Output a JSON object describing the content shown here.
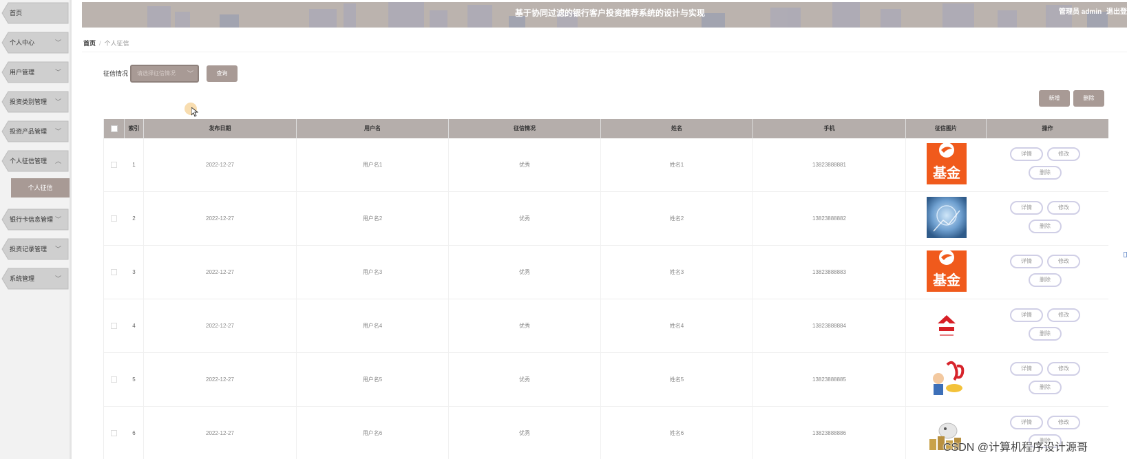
{
  "sidebar": {
    "items": [
      {
        "label": "首页"
      },
      {
        "label": "个人中心"
      },
      {
        "label": "用户管理"
      },
      {
        "label": "投资类别管理"
      },
      {
        "label": "投资产品管理"
      },
      {
        "label": "个人征信管理"
      },
      {
        "label": "银行卡信息管理"
      },
      {
        "label": "投资记录管理"
      },
      {
        "label": "系统管理"
      }
    ],
    "active_sub": "个人征信",
    "chevron_down": "﹀",
    "chevron_up": "︿"
  },
  "header": {
    "title": "基于协同过滤的银行客户投资推荐系统的设计与实现",
    "user": "管理员 admin",
    "logout": "退出登录"
  },
  "breadcrumb": {
    "home": "首页",
    "separator": "/",
    "current": "个人征信"
  },
  "search": {
    "label": "征信情况",
    "placeholder": "请选择征信情况",
    "button": "查询"
  },
  "actions": {
    "add": "新增",
    "delete": "删除"
  },
  "table": {
    "columns": [
      "索引",
      "发布日期",
      "用户名",
      "征信情况",
      "姓名",
      "手机",
      "征信图片",
      "操作"
    ],
    "rows": [
      {
        "index": "1",
        "date": "2022-12-27",
        "username": "用户名1",
        "credit": "优秀",
        "name": "姓名1",
        "phone": "13823888881",
        "image": "fund-logo"
      },
      {
        "index": "2",
        "date": "2022-12-27",
        "username": "用户名2",
        "credit": "优秀",
        "name": "姓名2",
        "phone": "13823888882",
        "image": "finance-blue"
      },
      {
        "index": "3",
        "date": "2022-12-27",
        "username": "用户名3",
        "credit": "优秀",
        "name": "姓名3",
        "phone": "13823888883",
        "image": "fund-logo"
      },
      {
        "index": "4",
        "date": "2022-12-27",
        "username": "用户名4",
        "credit": "优秀",
        "name": "姓名4",
        "phone": "13823888884",
        "image": "red-logo"
      },
      {
        "index": "5",
        "date": "2022-12-27",
        "username": "用户名5",
        "credit": "优秀",
        "name": "姓名5",
        "phone": "13823888885",
        "image": "cartoon"
      },
      {
        "index": "6",
        "date": "2022-12-27",
        "username": "用户名6",
        "credit": "优秀",
        "name": "姓名6",
        "phone": "13823888886",
        "image": "coins-piggy"
      }
    ],
    "row_actions": {
      "detail": "详情",
      "edit": "修改",
      "delete": "删除"
    },
    "fund_text": "基金"
  },
  "watermark": "CSDN @计算机程序设计源哥",
  "colors": {
    "accent": "#a89a95",
    "header_bg": "#b9b1ac",
    "table_header": "#b5aeab",
    "op_border": "#d0cfe6",
    "fund_orange": "#f05a1c"
  }
}
